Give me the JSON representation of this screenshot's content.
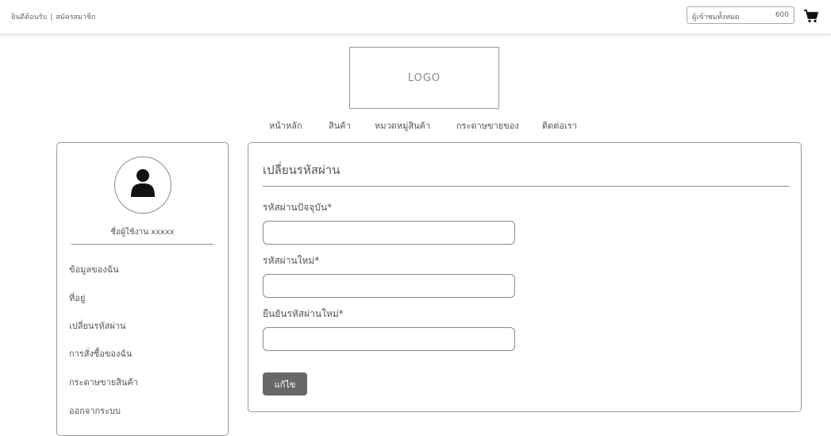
{
  "header": {
    "welcome_label": "ยินดีต้อนรับ",
    "separator": "|",
    "register_label": "สมัครสมาชิก",
    "visitors_label": "ผู้เข้าชมทั้งหมด",
    "visitors_count": "600",
    "cart_icon": "shopping-cart-icon"
  },
  "logo": {
    "text": "LOGO"
  },
  "nav": {
    "items": [
      {
        "label": "หน้าหลัก"
      },
      {
        "label": "สินค้า"
      },
      {
        "label": "หมวดหมู่สินค้า"
      },
      {
        "label": "กระดาษขายของ"
      },
      {
        "label": "ติดต่อเรา"
      }
    ]
  },
  "sidebar": {
    "avatar_icon": "user-icon",
    "username": "ชื่อผู้ใช้งาน xxxxx",
    "items": [
      {
        "label": "ข้อมูลของฉัน"
      },
      {
        "label": "ที่อยู่"
      },
      {
        "label": "เปลี่ยนรหัสผ่าน"
      },
      {
        "label": "การสั่งซื้อของฉัน"
      },
      {
        "label": "กระดาษขายสินค้า"
      },
      {
        "label": "ออกจากระบบ"
      }
    ]
  },
  "form": {
    "title": "เปลี่ยนรหัสผ่าน",
    "fields": [
      {
        "label": "รหัสผ่านปัจจุบัน*",
        "value": ""
      },
      {
        "label": "รหัสผ่านใหม่*",
        "value": ""
      },
      {
        "label": "ยืนยันรหัสผ่านใหม่*",
        "value": ""
      }
    ],
    "submit_label": "แก้ไข"
  }
}
